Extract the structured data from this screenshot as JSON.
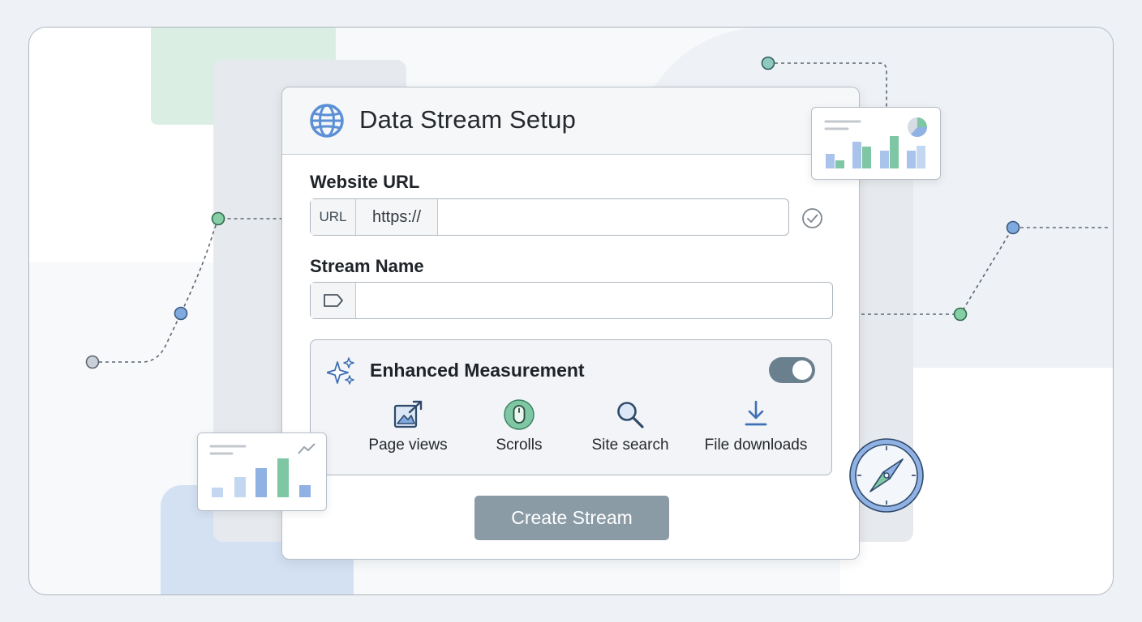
{
  "card": {
    "title": "Data Stream Setup",
    "website_url_label": "Website URL",
    "url_prefix_badge": "URL",
    "protocol": "https://",
    "website_url_value": "",
    "stream_name_label": "Stream Name",
    "stream_name_value": "",
    "enhanced_measurement": {
      "title": "Enhanced Measurement",
      "enabled": true,
      "features": [
        {
          "label": "Page views",
          "icon": "page-views-icon"
        },
        {
          "label": "Scrolls",
          "icon": "mouse-icon"
        },
        {
          "label": "Site search",
          "icon": "search-icon"
        },
        {
          "label": "File downloads",
          "icon": "download-icon"
        }
      ]
    },
    "create_button": "Create Stream"
  },
  "colors": {
    "accent_blue": "#5b8fd6",
    "accent_green": "#6cc29a",
    "button": "#8a9ba6",
    "toggle_on": "#6a808e"
  }
}
